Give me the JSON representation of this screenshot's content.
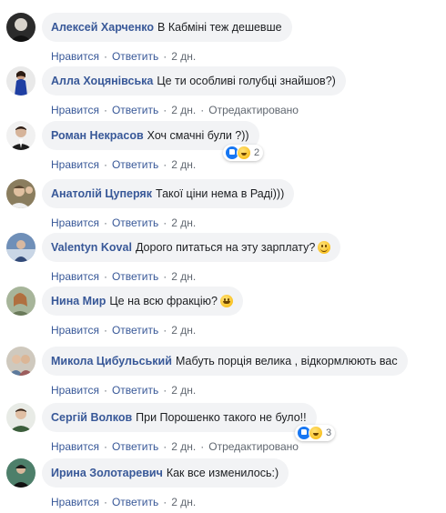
{
  "labels": {
    "like": "Нравится",
    "reply": "Ответить",
    "dot": "·",
    "edited": "Отредактировано"
  },
  "colors": {
    "author": "#385898",
    "bubble": "#f2f3f5",
    "meta": "#606770"
  },
  "comments": [
    {
      "author": "Алексей Харченко",
      "text": "В Кабміні теж дешевше",
      "time": "2 дн."
    },
    {
      "author": "Алла Хоцянівська",
      "text": "Це ти особливі голубці знайшов?)",
      "time": "2 дн."
    },
    {
      "author": "Роман Некрасов",
      "text": "Хоч смачні були ?))",
      "time": "2 дн.",
      "reaction_count": "2"
    },
    {
      "author": "Анатолій Цуперяк",
      "text": "Такої ціни нема в Раді)))",
      "time": "2 дн."
    },
    {
      "author": "Valentyn Koval",
      "text": "Дорого питаться на эту зарплату?",
      "time": "2 дн.",
      "emoji": "smiling-face-icon"
    },
    {
      "author": "Нина Мир",
      "text": "Це на всю фракцію?",
      "time": "2 дн.",
      "emoji": "laughing-face-icon"
    },
    {
      "author": "Микола Цибульський",
      "text": "Мабуть порція велика , відкормлюють вас",
      "time": "2 дн."
    },
    {
      "author": "Сергій Волков",
      "text": "При Порошенко такого не було!!",
      "time": "2 дн.",
      "reaction_count": "3"
    },
    {
      "author": "Ирина Золотаревич",
      "text": "Как все изменилось:)",
      "time": "2 дн."
    }
  ]
}
